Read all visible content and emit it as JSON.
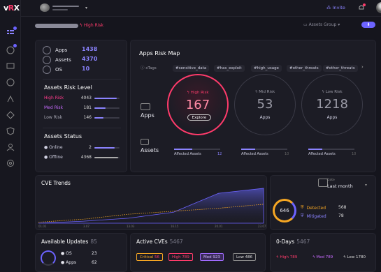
{
  "app": {
    "logo": "vRX"
  },
  "topbar": {
    "invite_label": "Invite"
  },
  "header": {
    "risk_filter": "High Risk",
    "group_select": "Assets Group"
  },
  "summary": {
    "items": [
      {
        "label": "Apps",
        "value": "1438"
      },
      {
        "label": "Assets",
        "value": "4370"
      },
      {
        "label": "OS",
        "value": "10"
      }
    ],
    "risk_level_title": "Assets Risk Level",
    "risk_levels": [
      {
        "label": "High Risk",
        "value": "4043",
        "fill": 0.9,
        "color": "#ff3b8b"
      },
      {
        "label": "Med Risk",
        "value": "181",
        "fill": 0.45,
        "color": "#c86bff"
      },
      {
        "label": "Low Risk",
        "value": "146",
        "fill": 0.35,
        "color": "#aaaab6"
      }
    ],
    "status_title": "Assets Status",
    "statuses": [
      {
        "label": "Online",
        "value": "2",
        "fill": 0.05
      },
      {
        "label": "Offline",
        "value": "4368",
        "fill": 0.95
      }
    ]
  },
  "risk_map": {
    "title": "Apps Risk Map",
    "tags_label": "xTags",
    "tags": [
      "#sensitive_data",
      "#has_exploit",
      "#high_usage",
      "#other_threats",
      "#other_threats"
    ],
    "row_apps": "Apps",
    "row_assets": "Assets",
    "circles": [
      {
        "label": "High Risk",
        "value": "167",
        "sub": "Explore",
        "color": "#ff3b6b"
      },
      {
        "label": "Mid Risk",
        "value": "53",
        "sub": "Apps",
        "color": "#9a9aa6"
      },
      {
        "label": "Low Risk",
        "value": "1218",
        "sub": "Apps",
        "color": "#9a9aa6"
      }
    ],
    "affected_label": "Affected Assets",
    "affected_values": [
      "12",
      "10",
      "10"
    ]
  },
  "cve_trends": {
    "title": "CVE Trends",
    "x_ticks": [
      "01.01",
      "3.07",
      "13.03",
      "16.15",
      "20.01",
      "23.07"
    ]
  },
  "chart_data": {
    "type": "area",
    "title": "CVE Trends",
    "categories": [
      "01.01",
      "3.07",
      "13.03",
      "16.15",
      "20.01",
      "23.07"
    ],
    "series": [
      {
        "values": [
          2,
          8,
          18,
          24,
          30,
          38
        ]
      },
      {
        "values": [
          0,
          4,
          10,
          22,
          60,
          70
        ]
      }
    ]
  },
  "detected": {
    "date_label": "Date",
    "date_value": "Last month",
    "total": "646",
    "items": [
      {
        "label": "Detected",
        "value": "568",
        "color": "#f5a623"
      },
      {
        "label": "Mitigated",
        "value": "78",
        "color": "#6c63ff"
      }
    ]
  },
  "updates": {
    "title": "Available Updates",
    "count": "85",
    "items": [
      {
        "label": "OS",
        "value": "23"
      },
      {
        "label": "Apps",
        "value": "62"
      }
    ]
  },
  "active_cves": {
    "title": "Active CVEs",
    "count": "5467",
    "pills": [
      {
        "label": "Critical",
        "value": "56"
      },
      {
        "label": "High",
        "value": "789"
      },
      {
        "label": "Med",
        "value": "923"
      },
      {
        "label": "Low",
        "value": "486"
      }
    ]
  },
  "zero_days": {
    "title": "0-Days",
    "count": "5467",
    "items": [
      {
        "label": "High",
        "value": "789"
      },
      {
        "label": "Med",
        "value": "789"
      },
      {
        "label": "Low",
        "value": "1780"
      }
    ]
  }
}
